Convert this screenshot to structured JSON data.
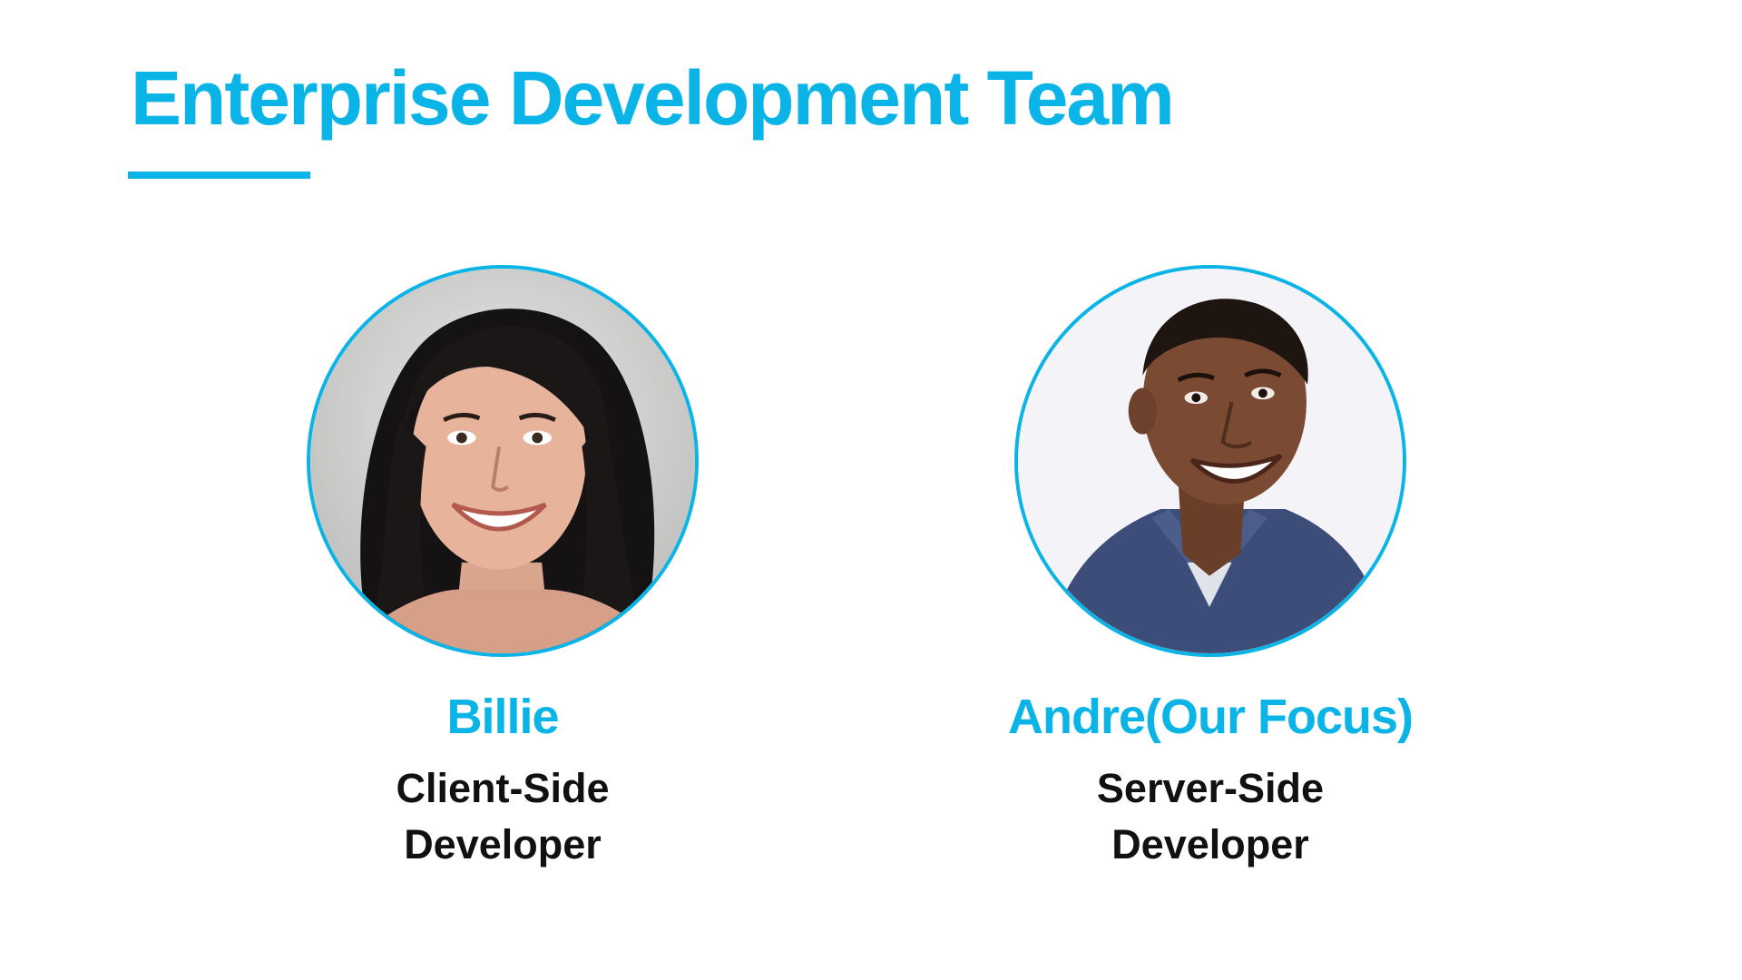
{
  "slide": {
    "title": "Enterprise Development Team"
  },
  "members": [
    {
      "name": "Billie",
      "role_line1": "Client-Side",
      "role_line2": "Developer",
      "photo": "portrait-woman-dark-hair-smiling"
    },
    {
      "name": "Andre(Our Focus)",
      "role_line1": "Server-Side",
      "role_line2": "Developer",
      "photo": "portrait-man-blue-shirt-smiling"
    }
  ],
  "colors": {
    "accent": "#0ab4e6",
    "text": "#111111",
    "background": "#ffffff"
  }
}
